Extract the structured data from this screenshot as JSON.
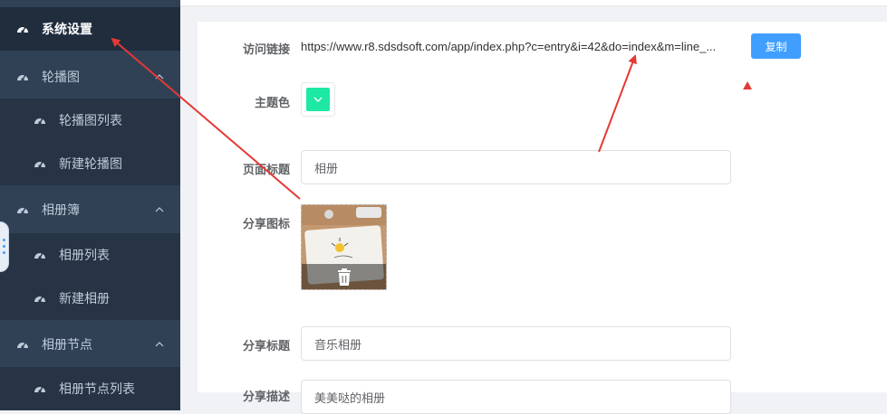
{
  "colors": {
    "sidebar_bg": "#304156",
    "submenu_bg": "#263445",
    "active_bg": "#1f2d3d",
    "accent": "#409eff",
    "theme_swatch": "#1de9a4",
    "annotation_red": "#e53935"
  },
  "sidebar": {
    "items": [
      {
        "label": "系统设置",
        "icon": "dashboard-icon",
        "active": true
      },
      {
        "label": "轮播图",
        "icon": "dashboard-icon",
        "expandable": true
      },
      {
        "label": "轮播图列表",
        "icon": "dashboard-icon",
        "sub": true
      },
      {
        "label": "新建轮播图",
        "icon": "dashboard-icon",
        "sub": true
      },
      {
        "label": "相册簿",
        "icon": "dashboard-icon",
        "expandable": true
      },
      {
        "label": "相册列表",
        "icon": "dashboard-icon",
        "sub": true
      },
      {
        "label": "新建相册",
        "icon": "dashboard-icon",
        "sub": true
      },
      {
        "label": "相册节点",
        "icon": "dashboard-icon",
        "expandable": true
      },
      {
        "label": "相册节点列表",
        "icon": "dashboard-icon",
        "sub": true
      }
    ]
  },
  "form": {
    "visit_link": {
      "label": "访问链接",
      "value": "https://www.r8.sdsdsoft.com/app/index.php?c=entry&i=42&do=index&m=line_...",
      "copy_label": "复制"
    },
    "theme_color": {
      "label": "主题色"
    },
    "page_title": {
      "label": "页面标题",
      "value": "相册"
    },
    "share_icon": {
      "label": "分享图标"
    },
    "share_title": {
      "label": "分享标题",
      "value": "音乐相册"
    },
    "share_desc": {
      "label": "分享描述",
      "value": "美美哒的相册"
    }
  }
}
